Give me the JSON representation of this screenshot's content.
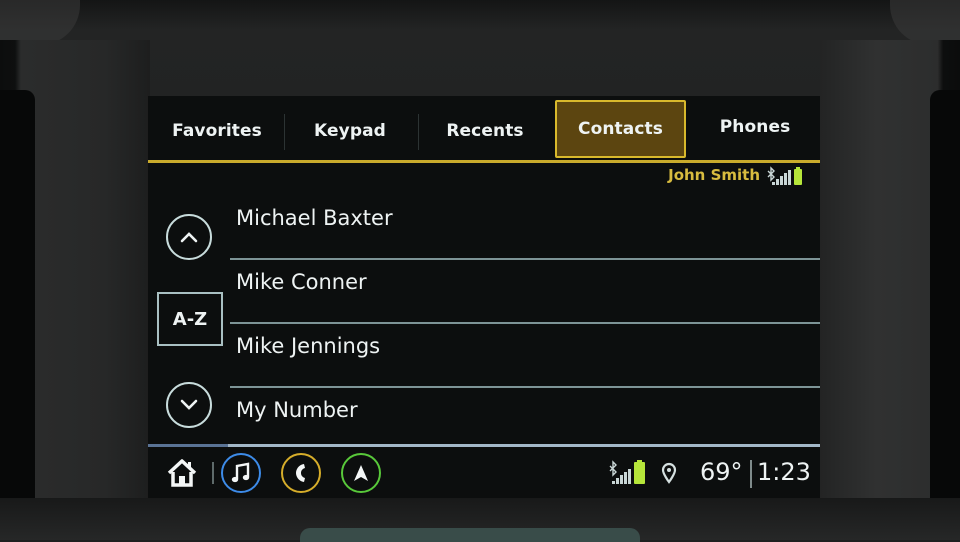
{
  "tabs": [
    {
      "label": "Favorites",
      "active": false
    },
    {
      "label": "Keypad",
      "active": false
    },
    {
      "label": "Recents",
      "active": false
    },
    {
      "label": "Contacts",
      "active": true
    },
    {
      "label": "Phones",
      "active": false
    }
  ],
  "status": {
    "connected_phone": "John Smith",
    "bluetooth_icon": "bluetooth-icon",
    "signal_icon": "signal-bars-icon",
    "battery_icon": "battery-icon"
  },
  "controls": {
    "scroll_up_icon": "chevron-up-icon",
    "az_label": "A-Z",
    "scroll_down_icon": "chevron-down-icon"
  },
  "contacts": [
    {
      "name": "Michael Baxter"
    },
    {
      "name": "Mike Conner"
    },
    {
      "name": "Mike Jennings"
    },
    {
      "name": "My Number"
    }
  ],
  "dock": {
    "apps": [
      {
        "name": "home-icon"
      },
      {
        "name": "music-icon",
        "color": "#3d8be8"
      },
      {
        "name": "phone-icon",
        "color": "#d6ad2a"
      },
      {
        "name": "navigation-icon",
        "color": "#58c83a"
      }
    ],
    "temperature": "69°",
    "time": "1:23"
  },
  "colors": {
    "accent_gold": "#d9b92c",
    "active_tab_bg": "#5c4510",
    "battery_green": "#b6e63a"
  }
}
